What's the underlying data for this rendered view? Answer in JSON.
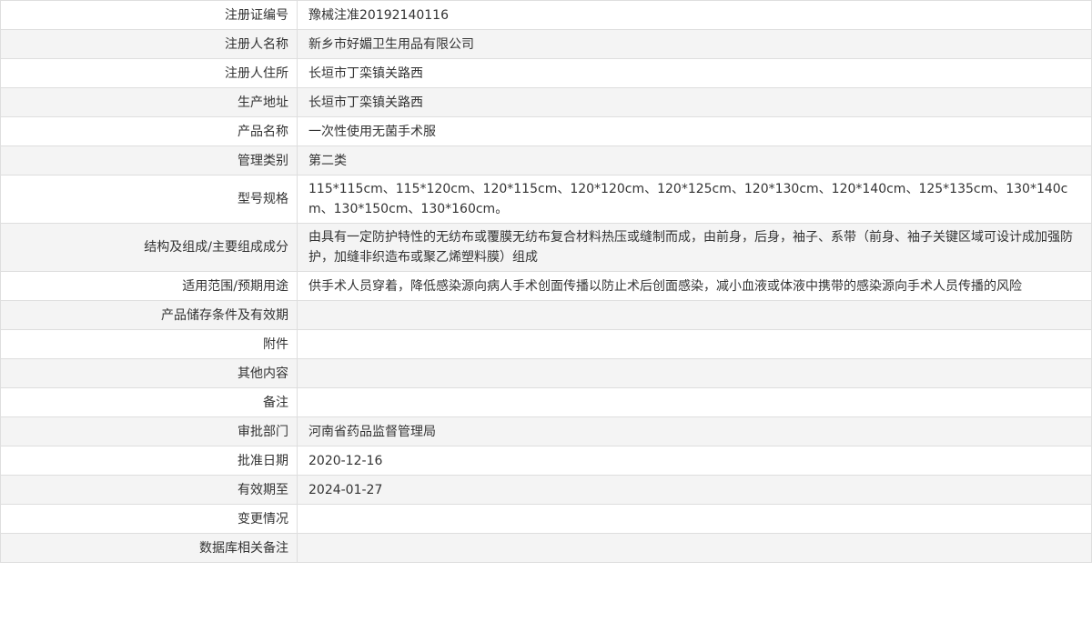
{
  "rows": [
    {
      "label": "注册证编号",
      "value": "豫械注准20192140116"
    },
    {
      "label": "注册人名称",
      "value": "新乡市好媚卫生用品有限公司"
    },
    {
      "label": "注册人住所",
      "value": "长垣市丁栾镇关路西"
    },
    {
      "label": "生产地址",
      "value": "长垣市丁栾镇关路西"
    },
    {
      "label": "产品名称",
      "value": "一次性使用无菌手术服"
    },
    {
      "label": "管理类别",
      "value": "第二类"
    },
    {
      "label": "型号规格",
      "value": "115*115cm、115*120cm、120*115cm、120*120cm、120*125cm、120*130cm、120*140cm、125*135cm、130*140cm、130*150cm、130*160cm。"
    },
    {
      "label": "结构及组成/主要组成成分",
      "value": "由具有一定防护特性的无纺布或覆膜无纺布复合材料热压或缝制而成，由前身，后身，袖子、系带（前身、袖子关键区域可设计成加强防护，加缝非织造布或聚乙烯塑料膜）组成"
    },
    {
      "label": "适用范围/预期用途",
      "value": "供手术人员穿着，降低感染源向病人手术创面传播以防止术后创面感染，减小血液或体液中携带的感染源向手术人员传播的风险"
    },
    {
      "label": "产品储存条件及有效期",
      "value": ""
    },
    {
      "label": "附件",
      "value": ""
    },
    {
      "label": "其他内容",
      "value": ""
    },
    {
      "label": "备注",
      "value": ""
    },
    {
      "label": "审批部门",
      "value": "河南省药品监督管理局"
    },
    {
      "label": "批准日期",
      "value": "2020-12-16"
    },
    {
      "label": "有效期至",
      "value": "2024-01-27"
    },
    {
      "label": "变更情况",
      "value": ""
    },
    {
      "label": "数据库相关备注",
      "value": ""
    }
  ]
}
